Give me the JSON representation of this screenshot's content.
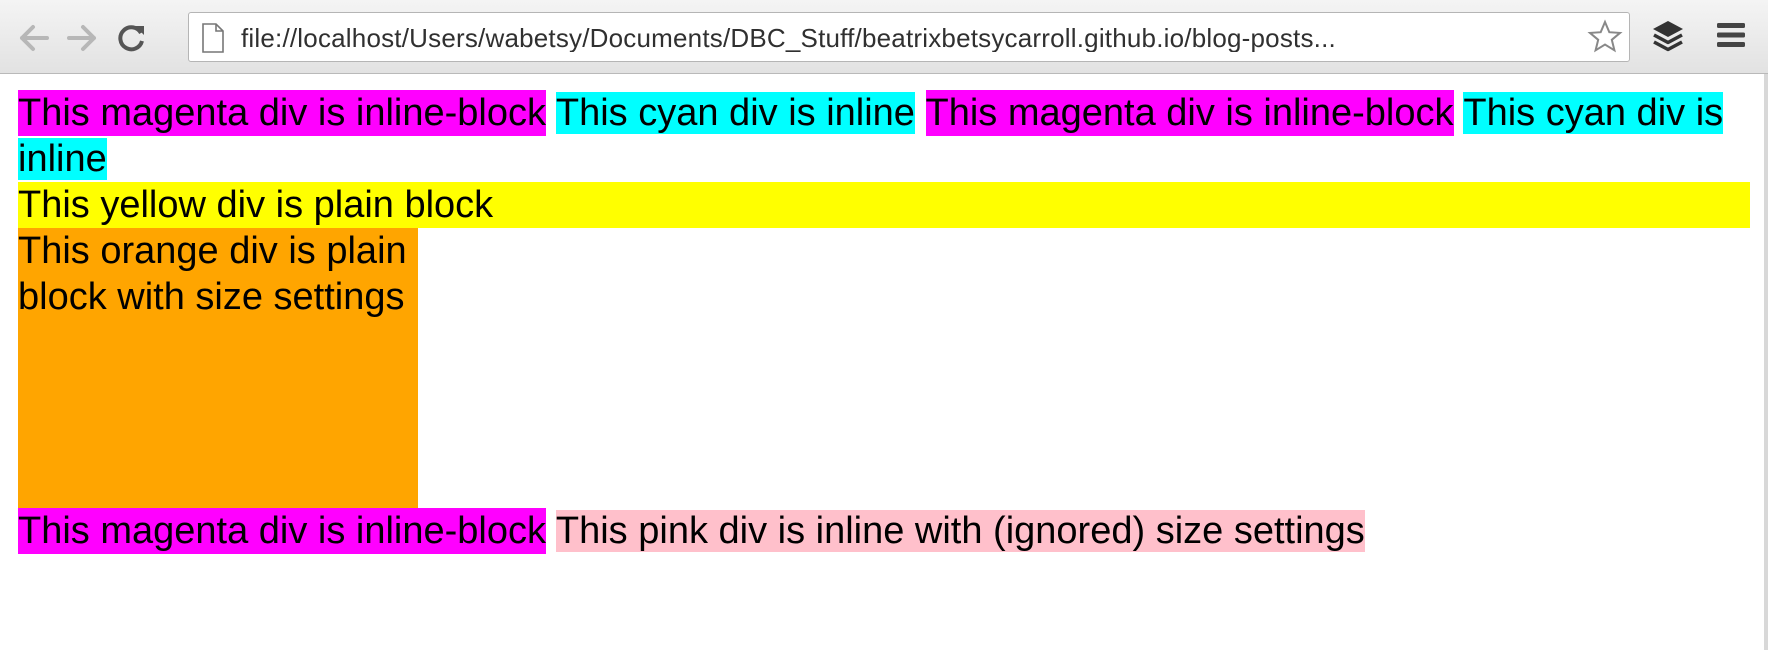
{
  "browser": {
    "url": "file://localhost/Users/wabetsy/Documents/DBC_Stuff/beatrixbetsycarroll.github.io/blog-posts..."
  },
  "page": {
    "line1": [
      {
        "text": "This magenta div is inline-block",
        "kind": "magenta"
      },
      {
        "text": "This cyan div is inline",
        "kind": "cyan"
      },
      {
        "text": "This magenta div is inline-block",
        "kind": "magenta"
      },
      {
        "text": "This cyan div is inline",
        "kind": "cyan"
      }
    ],
    "yellow_text": "This yellow div is plain block",
    "orange_text": "This orange div is plain block with size settings",
    "line_last": [
      {
        "text": "This magenta div is inline-block",
        "kind": "magenta"
      },
      {
        "text": "This pink div is inline with (ignored) size settings",
        "kind": "pink"
      }
    ]
  },
  "colors": {
    "magenta": "#ff00ff",
    "cyan": "#00ffff",
    "yellow": "#ffff00",
    "orange": "#ffa500",
    "pink": "#ffc0cb"
  },
  "icons": [
    "back-arrow-icon",
    "forward-arrow-icon",
    "reload-icon",
    "page-icon",
    "star-icon",
    "layers-extension-icon",
    "hamburger-menu-icon"
  ]
}
